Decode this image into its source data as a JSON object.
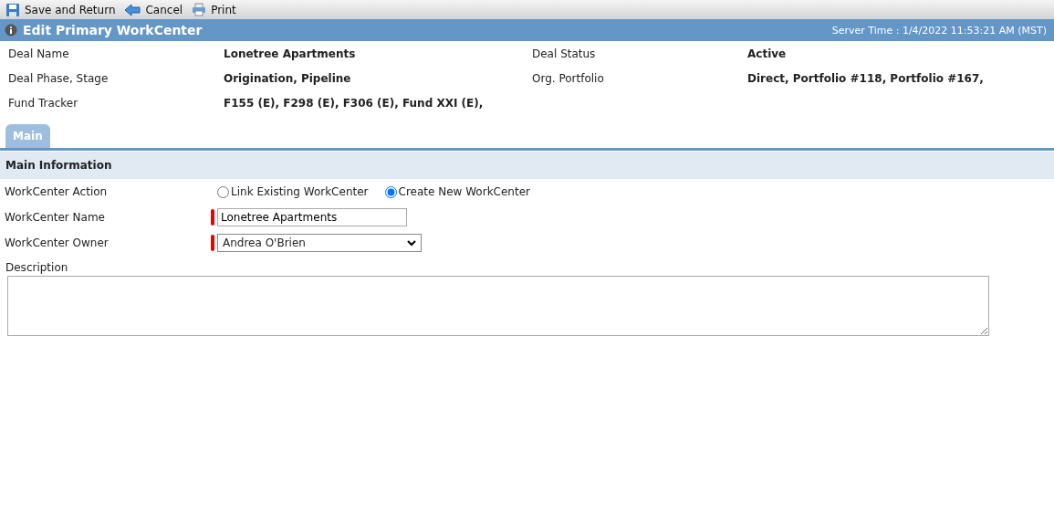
{
  "toolbar": [
    {
      "label": "Save and Return",
      "kind": "save"
    },
    {
      "label": "Cancel",
      "kind": "back"
    },
    {
      "label": "Print",
      "kind": "print"
    }
  ],
  "title": "Edit Primary WorkCenter",
  "server_time": "Server Time : 1/4/2022 11:53:21 AM (MST)",
  "info": [
    {
      "label": "Deal Name",
      "value": "Lonetree Apartments"
    },
    {
      "label": "Deal Status",
      "value": "Active"
    },
    {
      "label": "Deal Phase, Stage",
      "value": "Origination, Pipeline"
    },
    {
      "label": "Org. Portfolio",
      "value": "Direct, Portfolio #118, Portfolio #167,"
    },
    {
      "label": "Fund Tracker",
      "value": "F155 (E), F298 (E), F306 (E), Fund XXI (E),"
    }
  ],
  "tabs": [
    {
      "label": "Main",
      "selected": true
    }
  ],
  "section": "Main Information",
  "fields": [
    {
      "kind": "radio",
      "label": "WorkCenter Action",
      "required": false,
      "options": [
        {
          "label": "Link Existing WorkCenter",
          "selected": false
        },
        {
          "label": "Create New WorkCenter",
          "selected": true
        }
      ]
    },
    {
      "kind": "text",
      "label": "WorkCenter Name",
      "required": true,
      "value": "Lonetree Apartments"
    },
    {
      "kind": "select",
      "label": "WorkCenter Owner",
      "required": true,
      "value": "Andrea O'Brien"
    }
  ],
  "description": {
    "label": "Description"
  }
}
